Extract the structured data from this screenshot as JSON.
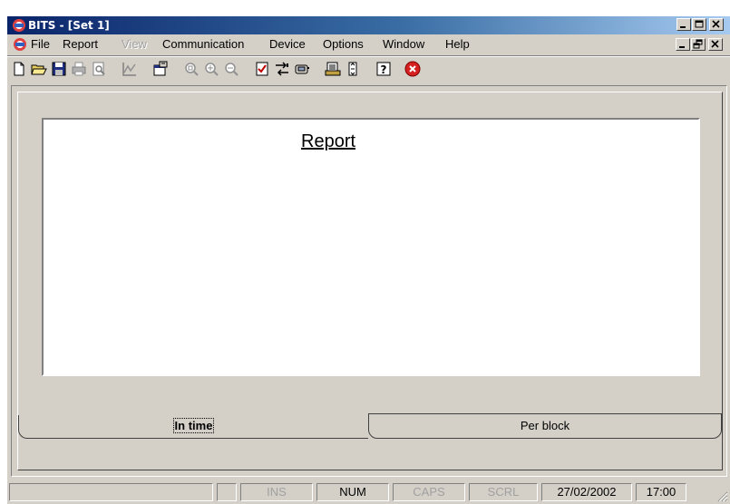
{
  "window": {
    "title": "BITS - [Set 1]"
  },
  "menu": {
    "items": [
      {
        "label": "File",
        "enabled": true
      },
      {
        "label": "Report",
        "enabled": true
      },
      {
        "label": "View",
        "enabled": false
      },
      {
        "label": "Communication",
        "enabled": true
      },
      {
        "label": "Device",
        "enabled": true
      },
      {
        "label": "Options",
        "enabled": true
      },
      {
        "label": "Window",
        "enabled": true
      },
      {
        "label": "Help",
        "enabled": true
      }
    ]
  },
  "toolbar": {
    "buttons": [
      "new-icon",
      "open-icon",
      "save-icon",
      "print-icon",
      "print-preview-icon",
      "chart-icon",
      "properties-icon",
      "zoom-fit-icon",
      "zoom-in-icon",
      "zoom-out-icon",
      "checklist-icon",
      "transfer-icon",
      "device-icon",
      "report-list-icon",
      "scroll-icon",
      "help-icon",
      "close-red-icon"
    ]
  },
  "report": {
    "title": "Report"
  },
  "tabs": [
    {
      "label": "In time",
      "active": true
    },
    {
      "label": "Per block",
      "active": false
    }
  ],
  "statusbar": {
    "ins": "INS",
    "num": "NUM",
    "caps": "CAPS",
    "scrl": "SCRL",
    "date": "27/02/2002",
    "time": "17:00"
  },
  "colors": {
    "titlebar_start": "#0a246a",
    "titlebar_end": "#a6caf0",
    "face": "#d4d0c8",
    "close_red": "#d42020"
  }
}
